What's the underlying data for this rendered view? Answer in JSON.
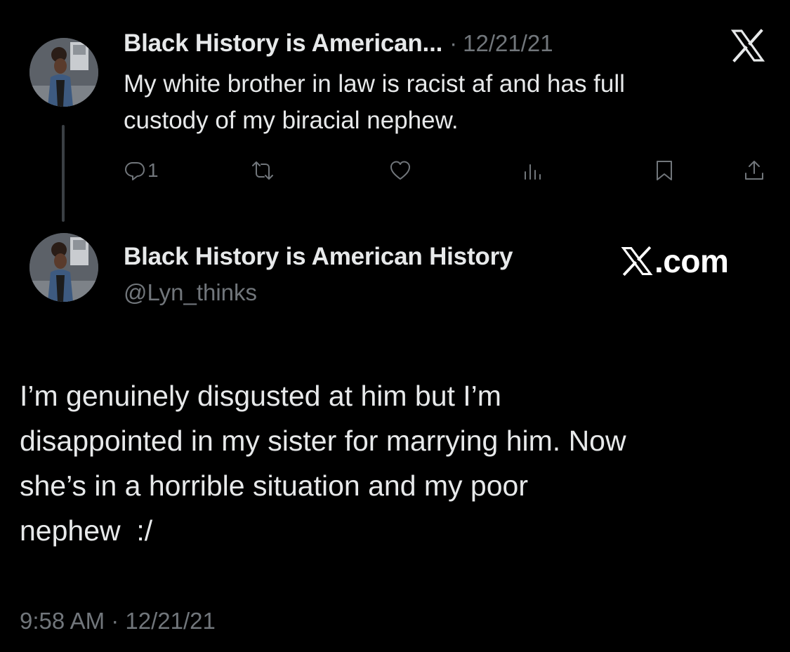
{
  "reply_tweet": {
    "author_name": "Black History is American...",
    "separator": "·",
    "date": "12/21/21",
    "text_lines": [
      "My white brother in law is racist af and has full",
      "custody of my biracial nephew."
    ],
    "actions": {
      "reply": {
        "icon": "reply-icon",
        "count": "1"
      },
      "repost": {
        "icon": "repost-icon"
      },
      "like": {
        "icon": "heart-icon"
      },
      "views": {
        "icon": "views-icon"
      },
      "bookmark": {
        "icon": "bookmark-icon"
      },
      "share": {
        "icon": "share-icon"
      }
    },
    "platform_logo": "x-logo-icon"
  },
  "main_tweet": {
    "author_name": "Black History is American History",
    "handle": "@Lyn_thinks",
    "branding": ".com",
    "text_lines": [
      "I’m genuinely disgusted at him but I’m",
      "disappointed in my sister for marrying him. Now",
      "she’s in a horrible situation and my poor",
      "nephew  :/"
    ],
    "timestamp": "9:58 AM · 12/21/21"
  },
  "colors": {
    "background": "#000000",
    "primary_text": "#e7e9ea",
    "secondary_text": "#71767b",
    "thread_line": "#3a3f44"
  }
}
